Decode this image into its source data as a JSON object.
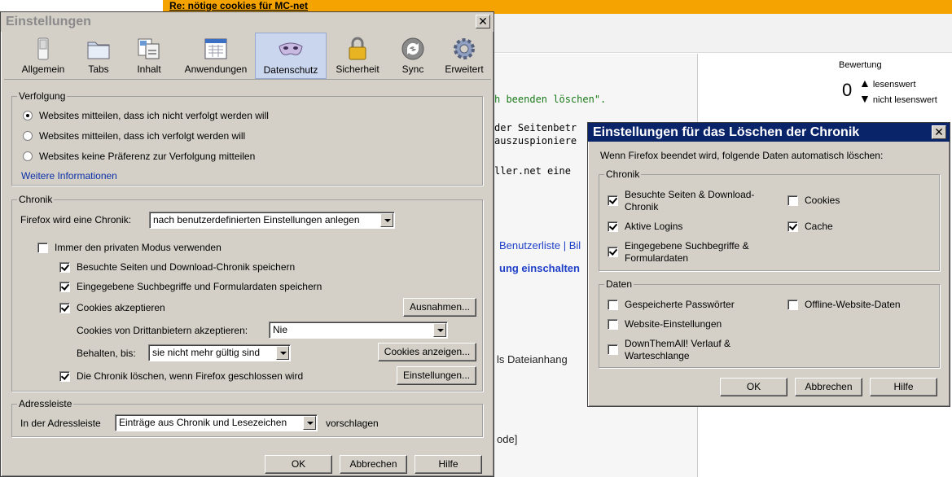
{
  "background": {
    "topbar_link": "Re: nötige cookies für MC-net",
    "mono_line1": "h beenden löschen\".",
    "mono_line2": "der Seitenbetr",
    "mono_line3": "auszuspioniere",
    "mono_line4": "ller.net eine",
    "links_line": "Benutzerliste | Bil",
    "bold_link": "ung einschalten",
    "text_attach": "ls Dateianhang",
    "text_code": "ode]",
    "rating": {
      "title": "Bewertung",
      "score": "0",
      "up": "lesenswert",
      "down": "nicht lesenswert"
    }
  },
  "prefs": {
    "title": "Einstellungen",
    "tabs": [
      {
        "label": "Allgemein",
        "icon": "switch-icon"
      },
      {
        "label": "Tabs",
        "icon": "folder-tabs-icon"
      },
      {
        "label": "Inhalt",
        "icon": "content-icon"
      },
      {
        "label": "Anwendungen",
        "icon": "applications-icon"
      },
      {
        "label": "Datenschutz",
        "icon": "mask-icon"
      },
      {
        "label": "Sicherheit",
        "icon": "lock-icon"
      },
      {
        "label": "Sync",
        "icon": "sync-icon"
      },
      {
        "label": "Erweitert",
        "icon": "gear-icon"
      }
    ],
    "tracking": {
      "legend": "Verfolgung",
      "opt1": "Websites mitteilen, dass ich nicht verfolgt werden will",
      "opt2": "Websites mitteilen, dass ich verfolgt werden will",
      "opt3": "Websites keine Präferenz zur Verfolgung mitteilen",
      "more_info": "Weitere Informationen"
    },
    "history": {
      "legend": "Chronik",
      "mode_label": "Firefox wird eine Chronik:",
      "mode_value": "nach benutzerdefinierten Einstellungen anlegen",
      "private_mode": "Immer den privaten Modus verwenden",
      "remember_history": "Besuchte Seiten und Download-Chronik speichern",
      "remember_forms": "Eingegebene Suchbegriffe und Formulardaten speichern",
      "accept_cookies": "Cookies akzeptieren",
      "exceptions_button": "Ausnahmen...",
      "third_party_label": "Cookies von Drittanbietern akzeptieren:",
      "third_party_value": "Nie",
      "keep_label": "Behalten, bis:",
      "keep_value": "sie nicht mehr gültig sind",
      "show_cookies_button": "Cookies anzeigen...",
      "clear_on_close": "Die Chronik löschen, wenn Firefox geschlossen wird",
      "settings_button": "Einstellungen..."
    },
    "addressbar": {
      "legend": "Adressleiste",
      "label": "In der Adressleiste",
      "value": "Einträge aus Chronik und Lesezeichen",
      "suffix": "vorschlagen"
    },
    "buttons": {
      "ok": "OK",
      "cancel": "Abbrechen",
      "help": "Hilfe"
    }
  },
  "clear_dialog": {
    "title": "Einstellungen für das Löschen der Chronik",
    "intro": "Wenn Firefox beendet wird, folgende Daten automatisch löschen:",
    "history": {
      "legend": "Chronik",
      "visited_1": "Besuchte Seiten & Download-",
      "visited_2": "Chronik",
      "cookies": "Cookies",
      "logins": "Aktive Logins",
      "cache": "Cache",
      "forms_1": "Eingegebene Suchbegriffe &",
      "forms_2": "Formulardaten"
    },
    "data": {
      "legend": "Daten",
      "passwords": "Gespeicherte Passwörter",
      "offline": "Offline-Website-Daten",
      "site_settings": "Website-Einstellungen",
      "dta_1": "DownThemAll! Verlauf &",
      "dta_2": "Warteschlange"
    },
    "buttons": {
      "ok": "OK",
      "cancel": "Abbrechen",
      "help": "Hilfe"
    }
  }
}
